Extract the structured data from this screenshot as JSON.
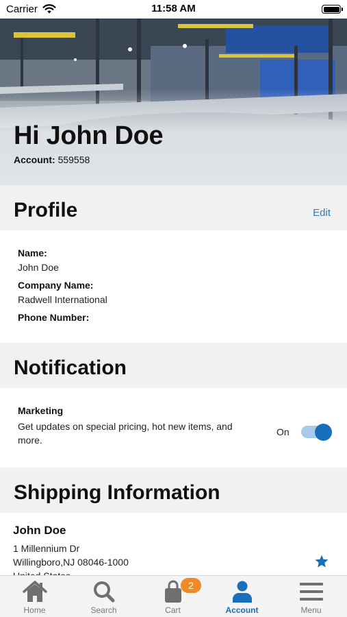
{
  "status_bar": {
    "carrier": "Carrier",
    "time": "11:58 AM"
  },
  "hero": {
    "greeting": "Hi John Doe",
    "account_label": "Account:",
    "account_number": "559558"
  },
  "profile": {
    "title": "Profile",
    "edit_label": "Edit",
    "name_label": "Name:",
    "name_value": "John Doe",
    "company_label": "Company Name:",
    "company_value": "Radwell International",
    "phone_label": "Phone Number:",
    "phone_value": ""
  },
  "notification": {
    "title": "Notification",
    "marketing_label": "Marketing",
    "marketing_desc": "Get updates on special pricing, hot new items, and more.",
    "toggle_state": "On",
    "toggle_on": true
  },
  "shipping": {
    "title": "Shipping Information",
    "name": "John Doe",
    "address_line1": "1 Millennium Dr",
    "address_line2": "Willingboro,NJ 08046-1000",
    "address_line3": "United States"
  },
  "tab_bar": {
    "tabs": [
      {
        "label": "Home",
        "icon": "home-icon"
      },
      {
        "label": "Search",
        "icon": "search-icon"
      },
      {
        "label": "Cart",
        "icon": "cart-icon",
        "badge": "2"
      },
      {
        "label": "Account",
        "icon": "account-icon",
        "active": true
      },
      {
        "label": "Menu",
        "icon": "menu-icon"
      }
    ]
  },
  "colors": {
    "accent": "#1a6fba",
    "link": "#2a7bbf",
    "badge": "#f08a24",
    "section_bg": "#f1f1f2"
  }
}
